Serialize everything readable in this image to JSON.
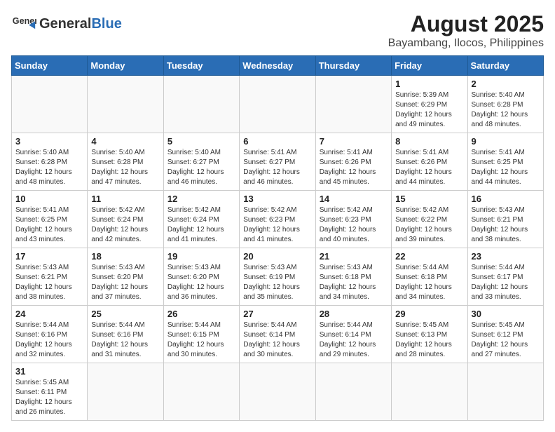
{
  "logo": {
    "text_general": "General",
    "text_blue": "Blue"
  },
  "title": "August 2025",
  "subtitle": "Bayambang, Ilocos, Philippines",
  "days_of_week": [
    "Sunday",
    "Monday",
    "Tuesday",
    "Wednesday",
    "Thursday",
    "Friday",
    "Saturday"
  ],
  "weeks": [
    [
      {
        "day": "",
        "info": ""
      },
      {
        "day": "",
        "info": ""
      },
      {
        "day": "",
        "info": ""
      },
      {
        "day": "",
        "info": ""
      },
      {
        "day": "",
        "info": ""
      },
      {
        "day": "1",
        "info": "Sunrise: 5:39 AM\nSunset: 6:29 PM\nDaylight: 12 hours\nand 49 minutes."
      },
      {
        "day": "2",
        "info": "Sunrise: 5:40 AM\nSunset: 6:28 PM\nDaylight: 12 hours\nand 48 minutes."
      }
    ],
    [
      {
        "day": "3",
        "info": "Sunrise: 5:40 AM\nSunset: 6:28 PM\nDaylight: 12 hours\nand 48 minutes."
      },
      {
        "day": "4",
        "info": "Sunrise: 5:40 AM\nSunset: 6:28 PM\nDaylight: 12 hours\nand 47 minutes."
      },
      {
        "day": "5",
        "info": "Sunrise: 5:40 AM\nSunset: 6:27 PM\nDaylight: 12 hours\nand 46 minutes."
      },
      {
        "day": "6",
        "info": "Sunrise: 5:41 AM\nSunset: 6:27 PM\nDaylight: 12 hours\nand 46 minutes."
      },
      {
        "day": "7",
        "info": "Sunrise: 5:41 AM\nSunset: 6:26 PM\nDaylight: 12 hours\nand 45 minutes."
      },
      {
        "day": "8",
        "info": "Sunrise: 5:41 AM\nSunset: 6:26 PM\nDaylight: 12 hours\nand 44 minutes."
      },
      {
        "day": "9",
        "info": "Sunrise: 5:41 AM\nSunset: 6:25 PM\nDaylight: 12 hours\nand 44 minutes."
      }
    ],
    [
      {
        "day": "10",
        "info": "Sunrise: 5:41 AM\nSunset: 6:25 PM\nDaylight: 12 hours\nand 43 minutes."
      },
      {
        "day": "11",
        "info": "Sunrise: 5:42 AM\nSunset: 6:24 PM\nDaylight: 12 hours\nand 42 minutes."
      },
      {
        "day": "12",
        "info": "Sunrise: 5:42 AM\nSunset: 6:24 PM\nDaylight: 12 hours\nand 41 minutes."
      },
      {
        "day": "13",
        "info": "Sunrise: 5:42 AM\nSunset: 6:23 PM\nDaylight: 12 hours\nand 41 minutes."
      },
      {
        "day": "14",
        "info": "Sunrise: 5:42 AM\nSunset: 6:23 PM\nDaylight: 12 hours\nand 40 minutes."
      },
      {
        "day": "15",
        "info": "Sunrise: 5:42 AM\nSunset: 6:22 PM\nDaylight: 12 hours\nand 39 minutes."
      },
      {
        "day": "16",
        "info": "Sunrise: 5:43 AM\nSunset: 6:21 PM\nDaylight: 12 hours\nand 38 minutes."
      }
    ],
    [
      {
        "day": "17",
        "info": "Sunrise: 5:43 AM\nSunset: 6:21 PM\nDaylight: 12 hours\nand 38 minutes."
      },
      {
        "day": "18",
        "info": "Sunrise: 5:43 AM\nSunset: 6:20 PM\nDaylight: 12 hours\nand 37 minutes."
      },
      {
        "day": "19",
        "info": "Sunrise: 5:43 AM\nSunset: 6:20 PM\nDaylight: 12 hours\nand 36 minutes."
      },
      {
        "day": "20",
        "info": "Sunrise: 5:43 AM\nSunset: 6:19 PM\nDaylight: 12 hours\nand 35 minutes."
      },
      {
        "day": "21",
        "info": "Sunrise: 5:43 AM\nSunset: 6:18 PM\nDaylight: 12 hours\nand 34 minutes."
      },
      {
        "day": "22",
        "info": "Sunrise: 5:44 AM\nSunset: 6:18 PM\nDaylight: 12 hours\nand 34 minutes."
      },
      {
        "day": "23",
        "info": "Sunrise: 5:44 AM\nSunset: 6:17 PM\nDaylight: 12 hours\nand 33 minutes."
      }
    ],
    [
      {
        "day": "24",
        "info": "Sunrise: 5:44 AM\nSunset: 6:16 PM\nDaylight: 12 hours\nand 32 minutes."
      },
      {
        "day": "25",
        "info": "Sunrise: 5:44 AM\nSunset: 6:16 PM\nDaylight: 12 hours\nand 31 minutes."
      },
      {
        "day": "26",
        "info": "Sunrise: 5:44 AM\nSunset: 6:15 PM\nDaylight: 12 hours\nand 30 minutes."
      },
      {
        "day": "27",
        "info": "Sunrise: 5:44 AM\nSunset: 6:14 PM\nDaylight: 12 hours\nand 30 minutes."
      },
      {
        "day": "28",
        "info": "Sunrise: 5:44 AM\nSunset: 6:14 PM\nDaylight: 12 hours\nand 29 minutes."
      },
      {
        "day": "29",
        "info": "Sunrise: 5:45 AM\nSunset: 6:13 PM\nDaylight: 12 hours\nand 28 minutes."
      },
      {
        "day": "30",
        "info": "Sunrise: 5:45 AM\nSunset: 6:12 PM\nDaylight: 12 hours\nand 27 minutes."
      }
    ],
    [
      {
        "day": "31",
        "info": "Sunrise: 5:45 AM\nSunset: 6:11 PM\nDaylight: 12 hours\nand 26 minutes."
      },
      {
        "day": "",
        "info": ""
      },
      {
        "day": "",
        "info": ""
      },
      {
        "day": "",
        "info": ""
      },
      {
        "day": "",
        "info": ""
      },
      {
        "day": "",
        "info": ""
      },
      {
        "day": "",
        "info": ""
      }
    ]
  ]
}
